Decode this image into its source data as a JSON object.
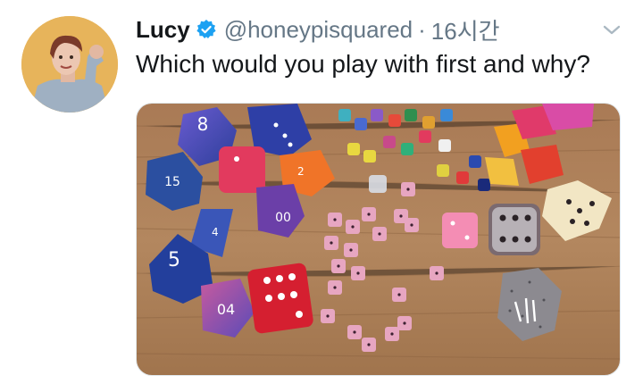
{
  "tweet": {
    "display_name": "Lucy",
    "handle": "@honeypisquared",
    "separator": "·",
    "time": "16시간",
    "text": "Which would you play with first and why?"
  },
  "icons": {
    "verified": "verified-badge-icon",
    "menu": "chevron-down-icon"
  },
  "colors": {
    "name": "#14171a",
    "secondary": "#657786",
    "verified": "#1da1f2",
    "avatar_bg": "#e7b45b"
  },
  "media": {
    "alt_description_shown": false,
    "dice_numbers": {
      "d12": "8",
      "d20": "5",
      "d10": "00",
      "d8": "2",
      "d4_numbers": "4",
      "d10_blue": "15",
      "d20_roll": "04"
    }
  }
}
